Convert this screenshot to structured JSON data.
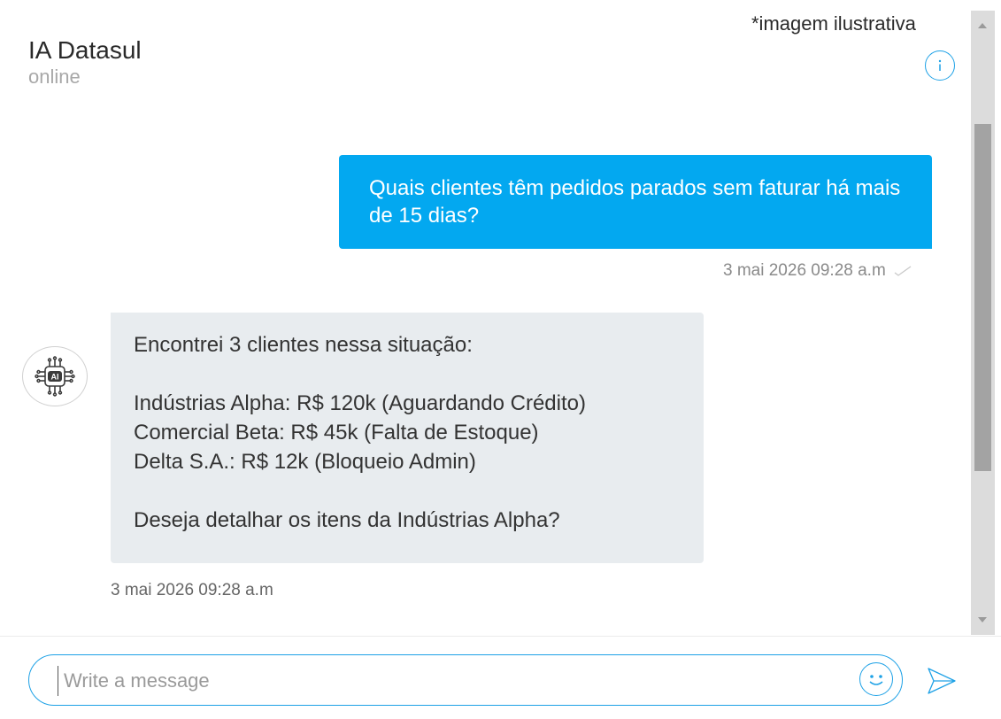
{
  "watermark": "*imagem ilustrativa",
  "header": {
    "title": "IA Datasul",
    "status": "online"
  },
  "messages": {
    "user": {
      "text": "Quais clientes têm pedidos parados sem faturar há mais de 15 dias?",
      "time": "3 mai 2026 09:28 a.m"
    },
    "bot": {
      "avatar_label": "AI",
      "lines": [
        "Encontrei 3 clientes nessa situação:",
        "",
        "Indústrias Alpha: R$ 120k (Aguardando Crédito)",
        "Comercial Beta: R$ 45k (Falta de Estoque)",
        "Delta S.A.: R$ 12k (Bloqueio Admin)",
        "",
        "Deseja detalhar os itens da Indústrias Alpha?"
      ],
      "time": "3 mai 2026 09:28 a.m"
    }
  },
  "composer": {
    "placeholder": "Write a message"
  },
  "icons": {
    "info": "info-icon",
    "check": "check-icon",
    "emoji": "emoji-icon",
    "send": "send-icon",
    "avatar": "ai-chip-icon"
  },
  "colors": {
    "accent": "#03a8f0",
    "bot_bubble": "#e8ecef"
  }
}
